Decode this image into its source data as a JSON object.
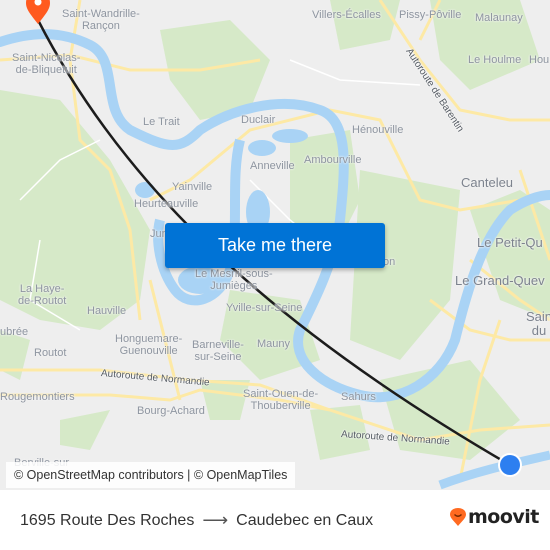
{
  "map": {
    "place_labels": [
      {
        "name": "Saint-Wandrille-\nRançon",
        "size": "normal"
      },
      {
        "name": "Villers-Écalles",
        "size": "normal"
      },
      {
        "name": "Pissy-Pôville",
        "size": "normal"
      },
      {
        "name": "Malaunay",
        "size": "normal"
      },
      {
        "name": "Le Houlme",
        "size": "normal"
      },
      {
        "name": "Hou",
        "size": "normal"
      },
      {
        "name": "Saint-Nicolas-\nde-Bliquetuit",
        "size": "normal"
      },
      {
        "name": "Le Trait",
        "size": "normal"
      },
      {
        "name": "Duclair",
        "size": "normal"
      },
      {
        "name": "Hénouville",
        "size": "normal"
      },
      {
        "name": "Anneville",
        "size": "normal"
      },
      {
        "name": "Ambourville",
        "size": "normal"
      },
      {
        "name": "Yainville",
        "size": "normal"
      },
      {
        "name": "Heurteauville",
        "size": "normal"
      },
      {
        "name": "Jumièges",
        "size": "normal"
      },
      {
        "name": "Canteleu",
        "size": "big"
      },
      {
        "name": "Le Petit-Qu",
        "size": "big"
      },
      {
        "name": "Le Grand-Quev",
        "size": "big"
      },
      {
        "name": "Sain\ndu",
        "size": "big"
      },
      {
        "name": "Le Mesnil-sous-\nJumièges",
        "size": "normal"
      },
      {
        "name": "La Haye-\nde-Routot",
        "size": "normal"
      },
      {
        "name": "Hauville",
        "size": "normal"
      },
      {
        "name": "Yville-sur-Seine",
        "size": "normal"
      },
      {
        "name": "ubrée",
        "size": "normal"
      },
      {
        "name": "Honguemare-\nGuenouville",
        "size": "normal"
      },
      {
        "name": "Routot",
        "size": "normal"
      },
      {
        "name": "Barneville-\nsur-Seine",
        "size": "normal"
      },
      {
        "name": "Mauny",
        "size": "normal"
      },
      {
        "name": "Rougemontiers",
        "size": "normal"
      },
      {
        "name": "Bourg-Achard",
        "size": "normal"
      },
      {
        "name": "Saint-Ouen-de-\nThouberville",
        "size": "normal"
      },
      {
        "name": "Sahurs",
        "size": "normal"
      },
      {
        "name": "Berville-sur",
        "size": "normal"
      },
      {
        "name": "on",
        "size": "normal"
      }
    ],
    "road_labels": [
      {
        "name": "Autoroute de Barentin"
      },
      {
        "name": "Autoroute de Normandie"
      },
      {
        "name": "Autoroute de Normandie"
      }
    ],
    "origin_marker": {
      "icon": "location-pin-icon",
      "color": "#ff5a1f"
    },
    "destination_marker": {
      "icon": "current-location-dot-icon",
      "color": "#2d7ff0"
    },
    "route_color": "#1c1c1c",
    "water_color": "#a9d3f5",
    "forest_color": "#d5e8c6",
    "road_color": "#fde9a5"
  },
  "cta": {
    "label": "Take me there",
    "color": "#0073d6"
  },
  "attribution": "© OpenStreetMap contributors | © OpenMapTiles",
  "footer": {
    "origin": "1695 Route Des Roches",
    "arrow": "⟶",
    "destination": "Caudebec en Caux",
    "brand": "moovit",
    "brand_color": "#ff6a21"
  }
}
